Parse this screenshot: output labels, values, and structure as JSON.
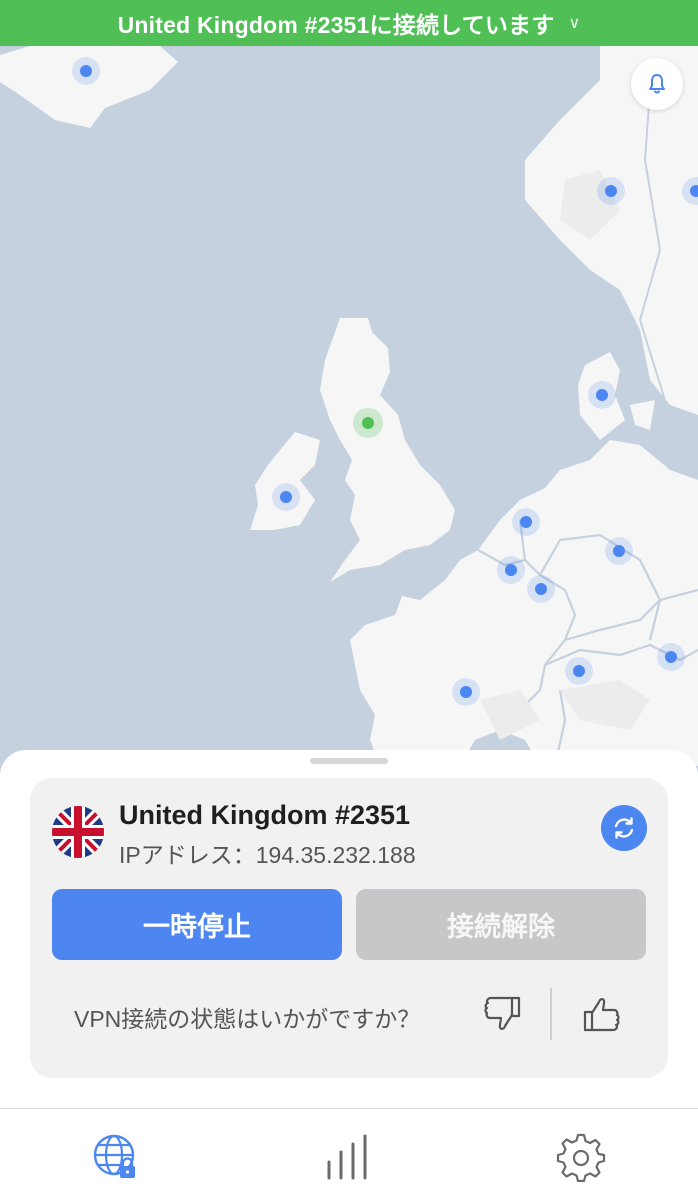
{
  "status_bar": {
    "connected_text": "United Kingdom #2351に接続しています"
  },
  "map": {
    "land_color": "#f6f6f6",
    "sea_color": "#c5d1df",
    "server_dot_color": "#4c86f0",
    "connected_dot_color": "#4fbf56",
    "server_pins": [
      "iceland",
      "norway",
      "sweden",
      "denmark",
      "ireland",
      "netherlands",
      "germany",
      "belgium",
      "luxembourg",
      "switzerland",
      "austria",
      "france"
    ],
    "connected_pin": "united-kingdom"
  },
  "connection": {
    "server_name": "United Kingdom #2351",
    "ip_label": "IPアドレス：",
    "ip_address": "194.35.232.188",
    "flag_icon": "uk-flag-icon",
    "refresh_icon": "refresh-icon"
  },
  "actions": {
    "pause_label": "一時停止",
    "disconnect_label": "接続解除"
  },
  "feedback": {
    "question": "VPN接続の状態はいかがですか？",
    "thumbs_down_icon": "thumbs-down-icon",
    "thumbs_up_icon": "thumbs-up-icon"
  },
  "nav": {
    "items": [
      {
        "icon": "globe-lock-icon",
        "active": true
      },
      {
        "icon": "bars-icon",
        "active": false
      },
      {
        "icon": "gear-icon",
        "active": false
      }
    ],
    "active_color": "#4c86f0",
    "inactive_color": "#6b6b6b"
  }
}
